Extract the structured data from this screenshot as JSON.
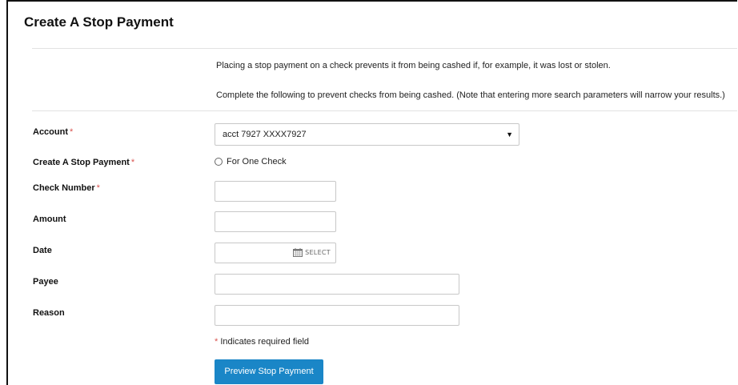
{
  "page": {
    "title": "Create A Stop Payment",
    "intro_line_1": "Placing a stop payment on a check prevents it from being cashed if, for example, it was lost or stolen.",
    "intro_line_2": "Complete the following to prevent checks from being cashed. (Note that entering more search parameters will narrow your results.)"
  },
  "form": {
    "account": {
      "label": "Account",
      "required_mark": "*",
      "selected": "acct 7927 XXXX7927"
    },
    "stop_type": {
      "label": "Create A Stop Payment",
      "required_mark": "*",
      "option_label": "For One Check"
    },
    "check_number": {
      "label": "Check Number",
      "required_mark": "*",
      "value": ""
    },
    "amount": {
      "label": "Amount",
      "value": ""
    },
    "date": {
      "label": "Date",
      "value": "",
      "select_label": "SELECT"
    },
    "payee": {
      "label": "Payee",
      "value": ""
    },
    "reason": {
      "label": "Reason",
      "value": ""
    },
    "required_note_mark": "*",
    "required_note": "Indicates required field",
    "submit_label": "Preview Stop Payment"
  },
  "colors": {
    "primary_button": "#1a86c7",
    "required": "#d9534f"
  },
  "icons": {
    "date_picker": "calendar-icon",
    "account_dropdown": "caret-down-icon"
  }
}
